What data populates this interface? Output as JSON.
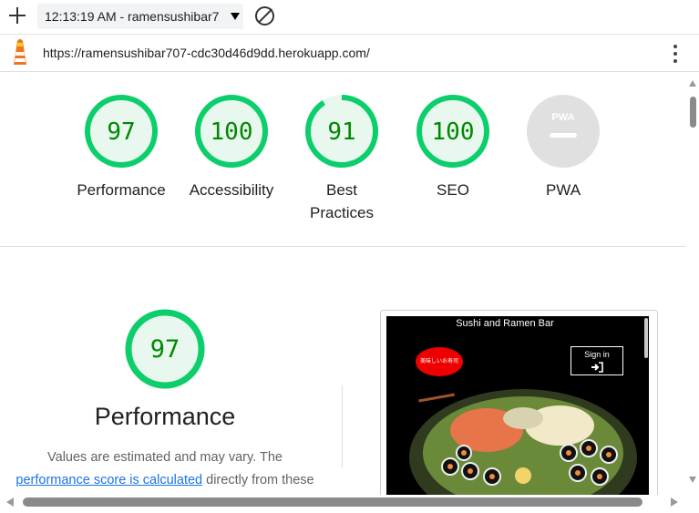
{
  "toolbar": {
    "new_report_icon": "plus-icon",
    "report_selector": "12:13:19 AM - ramensushibar7",
    "clear_icon": "block-icon"
  },
  "urlbar": {
    "logo_icon": "lighthouse-icon",
    "url": "https://ramensushibar707-cdc30d46d9dd.herokuapp.com/",
    "menu_icon": "kebab-menu-icon"
  },
  "scores": [
    {
      "label": "Performance",
      "value": "97"
    },
    {
      "label": "Accessibility",
      "value": "100"
    },
    {
      "label": "Best Practices",
      "value": "91"
    },
    {
      "label": "SEO",
      "value": "100"
    },
    {
      "label": "PWA",
      "value": "PWA"
    }
  ],
  "performance": {
    "score": "97",
    "title": "Performance",
    "note_before": "Values are estimated and may vary. The",
    "note_link": "performance score is calculated",
    "note_after": " directly from these"
  },
  "screenshot": {
    "site_title": "Sushi and Ramen Bar",
    "logo_text": "美味しいお寿司",
    "signin_label": "Sign in",
    "signin_icon": "login-arrow-icon"
  },
  "colors": {
    "pass_green": "#0cce6b",
    "pass_fill": "#e8f8ef",
    "pass_text": "#008800",
    "na_gray": "#e0e0e0",
    "link_blue": "#1a73e8"
  }
}
